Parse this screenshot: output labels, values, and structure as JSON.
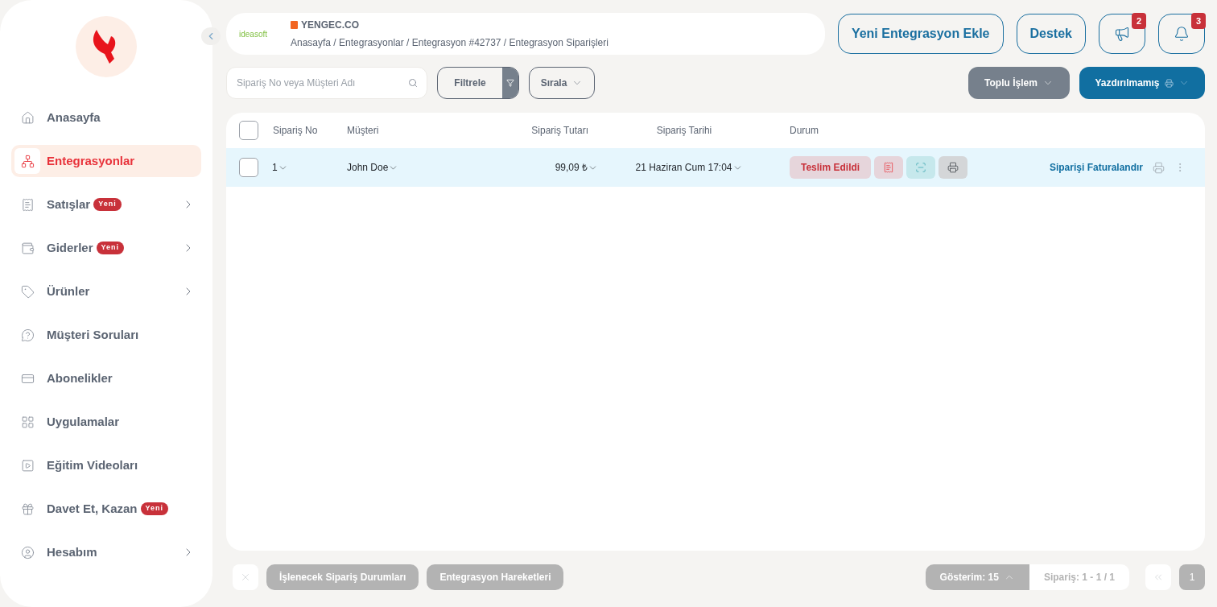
{
  "sidebar": {
    "items": [
      {
        "label": "Anasayfa",
        "selected": false,
        "expandable": false
      },
      {
        "label": "Entegrasyonlar",
        "selected": true,
        "expandable": false
      },
      {
        "label": "Satışlar",
        "selected": false,
        "expandable": true,
        "badge": "Yeni"
      },
      {
        "label": "Giderler",
        "selected": false,
        "expandable": true,
        "badge": "Yeni"
      },
      {
        "label": "Ürünler",
        "selected": false,
        "expandable": true
      },
      {
        "label": "Müşteri Soruları",
        "selected": false,
        "expandable": false
      },
      {
        "label": "Abonelikler",
        "selected": false,
        "expandable": false
      },
      {
        "label": "Uygulamalar",
        "selected": false,
        "expandable": false
      },
      {
        "label": "Eğitim Videoları",
        "selected": false,
        "expandable": false
      },
      {
        "label": "Davet Et, Kazan",
        "selected": false,
        "expandable": false,
        "badge": "Yeni"
      },
      {
        "label": "Hesabım",
        "selected": false,
        "expandable": true
      }
    ]
  },
  "header": {
    "platform_logo": "ideasoft",
    "store": "YENGEC.CO",
    "breadcrumb": "Anasayfa / Entegrasyonlar / Entegrasyon #42737 / Entegrasyon Siparişleri",
    "add_button": "Yeni Entegrasyon Ekle",
    "support_button": "Destek",
    "announcements_count": "2",
    "notifications_count": "3"
  },
  "toolbar": {
    "search": {
      "placeholder": "Sipariş No veya Müşteri Adı"
    },
    "filter": "Filtrele",
    "sort": "Sırala",
    "bulk": "Toplu İşlem",
    "print_filter": "Yazdırılmamış"
  },
  "table": {
    "select_all": {
      "checked": false
    },
    "columns": [
      "Sipariş No",
      "Müşteri",
      "Sipariş Tutarı",
      "Sipariş Tarihi",
      "Durum"
    ],
    "rows": [
      {
        "checked": false,
        "order_no": "1",
        "customer": "John Doe",
        "amount": "99,09 ₺",
        "date": "21 Haziran Cum 17:04",
        "status": "Teslim Edildi",
        "action": "Siparişi Faturalandır"
      }
    ]
  },
  "footer": {
    "buttons": [
      "İşlenecek Sipariş Durumları",
      "Entegrasyon Hareketleri"
    ],
    "page_size": "Gösterim: 15",
    "range": "Sipariş: 1 - 1 / 1",
    "pages": [
      {
        "label": "1",
        "selected": true
      }
    ]
  }
}
